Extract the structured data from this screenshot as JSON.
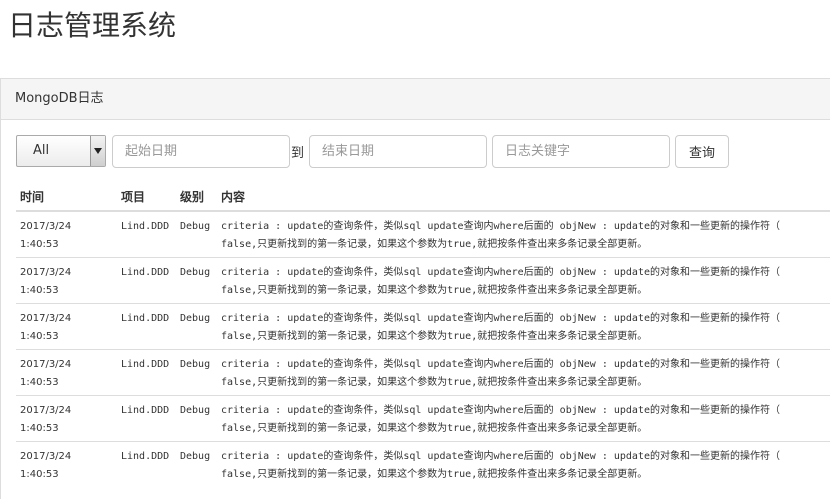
{
  "page_title": "日志管理系统",
  "panel": {
    "heading": "MongoDB日志"
  },
  "filters": {
    "select_value": "All",
    "start_placeholder": "起始日期",
    "to_label": "到",
    "end_placeholder": "结束日期",
    "keyword_placeholder": "日志关键字",
    "query_label": "查询"
  },
  "table": {
    "headers": [
      "时间",
      "项目",
      "级别",
      "内容"
    ],
    "rows": [
      {
        "time_date": "2017/3/24",
        "time_clock": "1:40:53",
        "project": "Lind.DDD",
        "level": "Debug",
        "line1": "criteria : update的查询条件，类似sql update查询内where后面的 objNew : update的对象和一些更新的操作符（",
        "line2": "false,只更新找到的第一条记录，如果这个参数为true,就把按条件查出来多条记录全部更新。"
      },
      {
        "time_date": "2017/3/24",
        "time_clock": "1:40:53",
        "project": "Lind.DDD",
        "level": "Debug",
        "line1": "criteria : update的查询条件，类似sql update查询内where后面的 objNew : update的对象和一些更新的操作符（",
        "line2": "false,只更新找到的第一条记录，如果这个参数为true,就把按条件查出来多条记录全部更新。"
      },
      {
        "time_date": "2017/3/24",
        "time_clock": "1:40:53",
        "project": "Lind.DDD",
        "level": "Debug",
        "line1": "criteria : update的查询条件，类似sql update查询内where后面的 objNew : update的对象和一些更新的操作符（",
        "line2": "false,只更新找到的第一条记录，如果这个参数为true,就把按条件查出来多条记录全部更新。"
      },
      {
        "time_date": "2017/3/24",
        "time_clock": "1:40:53",
        "project": "Lind.DDD",
        "level": "Debug",
        "line1": "criteria : update的查询条件，类似sql update查询内where后面的 objNew : update的对象和一些更新的操作符（",
        "line2": "false,只更新找到的第一条记录，如果这个参数为true,就把按条件查出来多条记录全部更新。"
      },
      {
        "time_date": "2017/3/24",
        "time_clock": "1:40:53",
        "project": "Lind.DDD",
        "level": "Debug",
        "line1": "criteria : update的查询条件，类似sql update查询内where后面的 objNew : update的对象和一些更新的操作符（",
        "line2": "false,只更新找到的第一条记录，如果这个参数为true,就把按条件查出来多条记录全部更新。"
      },
      {
        "time_date": "2017/3/24",
        "time_clock": "1:40:53",
        "project": "Lind.DDD",
        "level": "Debug",
        "line1": "criteria : update的查询条件，类似sql update查询内where后面的 objNew : update的对象和一些更新的操作符（",
        "line2": "false,只更新找到的第一条记录，如果这个参数为true,就把按条件查出来多条记录全部更新。"
      }
    ]
  }
}
